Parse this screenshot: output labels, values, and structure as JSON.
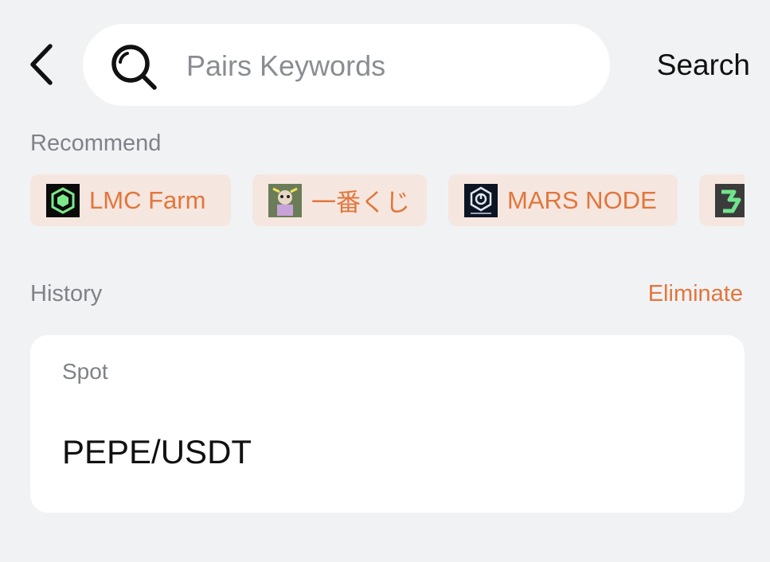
{
  "header": {
    "back_label": "‹",
    "search": {
      "placeholder": "Pairs Keywords",
      "value": ""
    },
    "search_button": "Search"
  },
  "recommend": {
    "title": "Recommend",
    "items": [
      {
        "label": "LMC Farm",
        "logo": "lmc-farm-logo"
      },
      {
        "label": "一番くじ",
        "logo": "ichiban-kuji-logo"
      },
      {
        "label": "MARS NODE",
        "logo": "mars-node-logo"
      },
      {
        "label": "",
        "logo": "partial-token-logo"
      }
    ]
  },
  "history": {
    "title": "History",
    "clear_label": "Eliminate",
    "card": {
      "category": "Spot",
      "pair": "PEPE/USDT"
    }
  },
  "colors": {
    "background": "#f1f2f4",
    "accent": "#e2763c",
    "chip_background": "#f5e6df",
    "muted_text": "#7f8288"
  }
}
